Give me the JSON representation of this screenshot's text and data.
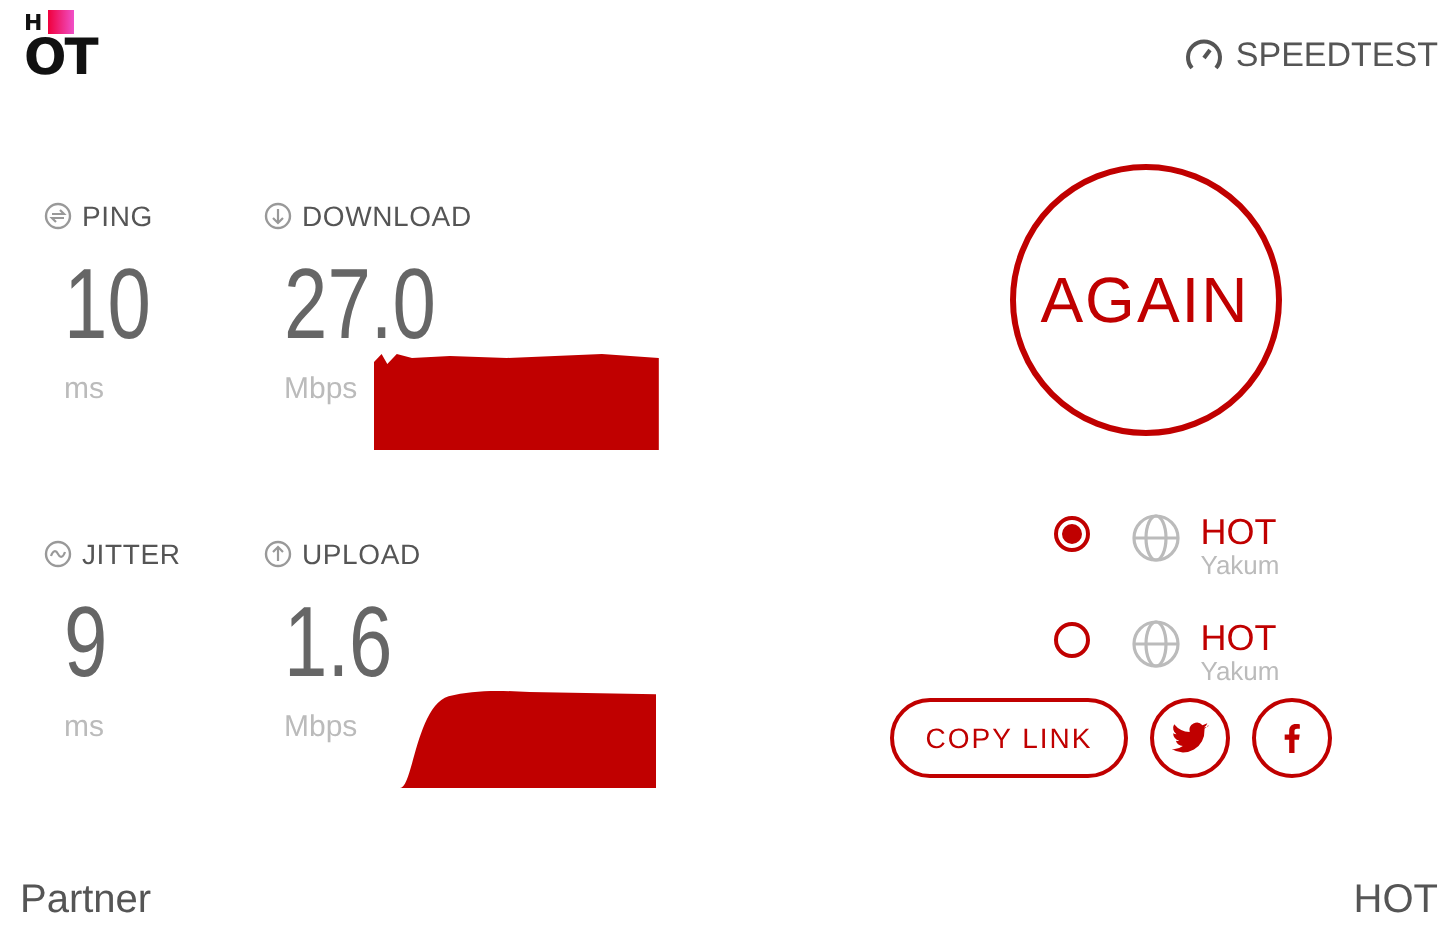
{
  "logo": {
    "top": "H",
    "bottom": "OT"
  },
  "brand": "SPEEDTEST",
  "metrics": [
    {
      "label": "PING",
      "value": "10",
      "unit": "ms",
      "kind": "latency"
    },
    {
      "label": "DOWNLOAD",
      "value": "27.0",
      "unit": "Mbps",
      "kind": "speed"
    },
    {
      "label": "JITTER",
      "value": "9",
      "unit": "ms",
      "kind": "latency"
    },
    {
      "label": "UPLOAD",
      "value": "1.6",
      "unit": "Mbps",
      "kind": "speed"
    }
  ],
  "again_button": "AGAIN",
  "servers": [
    {
      "name": "HOT",
      "location": "Yakum",
      "selected": true
    },
    {
      "name": "HOT",
      "location": "Yakum",
      "selected": false
    }
  ],
  "copy_link_button": "COPY LINK",
  "footer": {
    "left": "Partner",
    "right": "HOT"
  }
}
